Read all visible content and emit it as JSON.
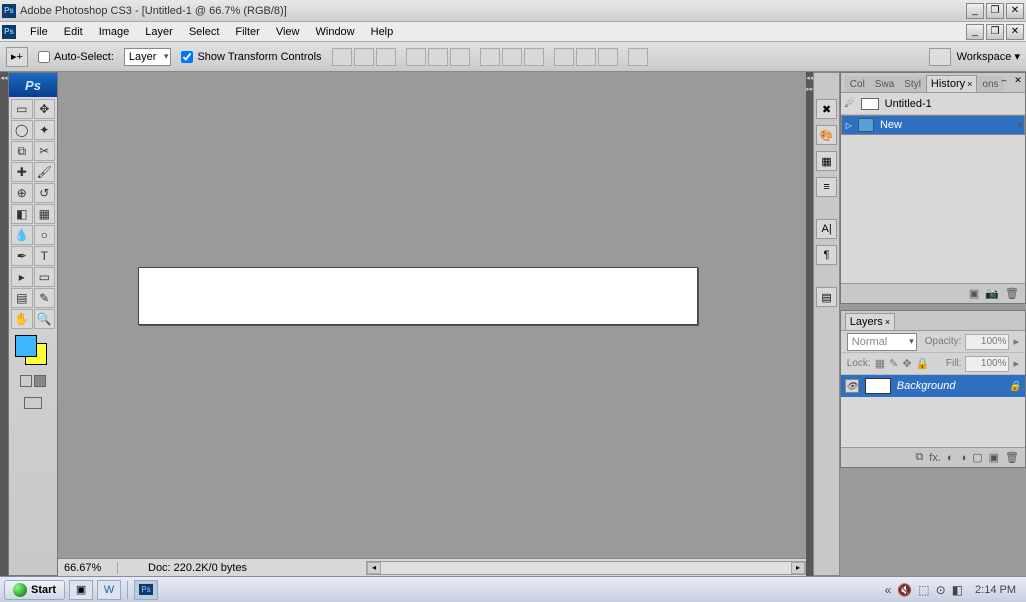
{
  "title": "Adobe Photoshop CS3 - [Untitled-1 @ 66.7% (RGB/8)]",
  "menu": [
    "File",
    "Edit",
    "Image",
    "Layer",
    "Select",
    "Filter",
    "View",
    "Window",
    "Help"
  ],
  "optbar": {
    "autoselect": "Auto-Select:",
    "autoselect_val": "Layer",
    "showtransform": "Show Transform Controls",
    "workspace": "Workspace"
  },
  "history": {
    "tabs": [
      "Col",
      "Swa",
      "Styl",
      "History",
      "ons"
    ],
    "doc": "Untitled-1",
    "state": "New"
  },
  "layers": {
    "tab": "Layers",
    "blend": "Normal",
    "opacity_lbl": "Opacity:",
    "opacity": "100%",
    "lock_lbl": "Lock:",
    "fill_lbl": "Fill:",
    "fill": "100%",
    "bg": "Background"
  },
  "status": {
    "zoom": "66.67%",
    "doc": "Doc: 220.2K/0 bytes"
  },
  "taskbar": {
    "start": "Start",
    "time": "2:14 PM"
  },
  "colors": {
    "fg": "#3cb7fd",
    "bg": "#ffff3c"
  }
}
